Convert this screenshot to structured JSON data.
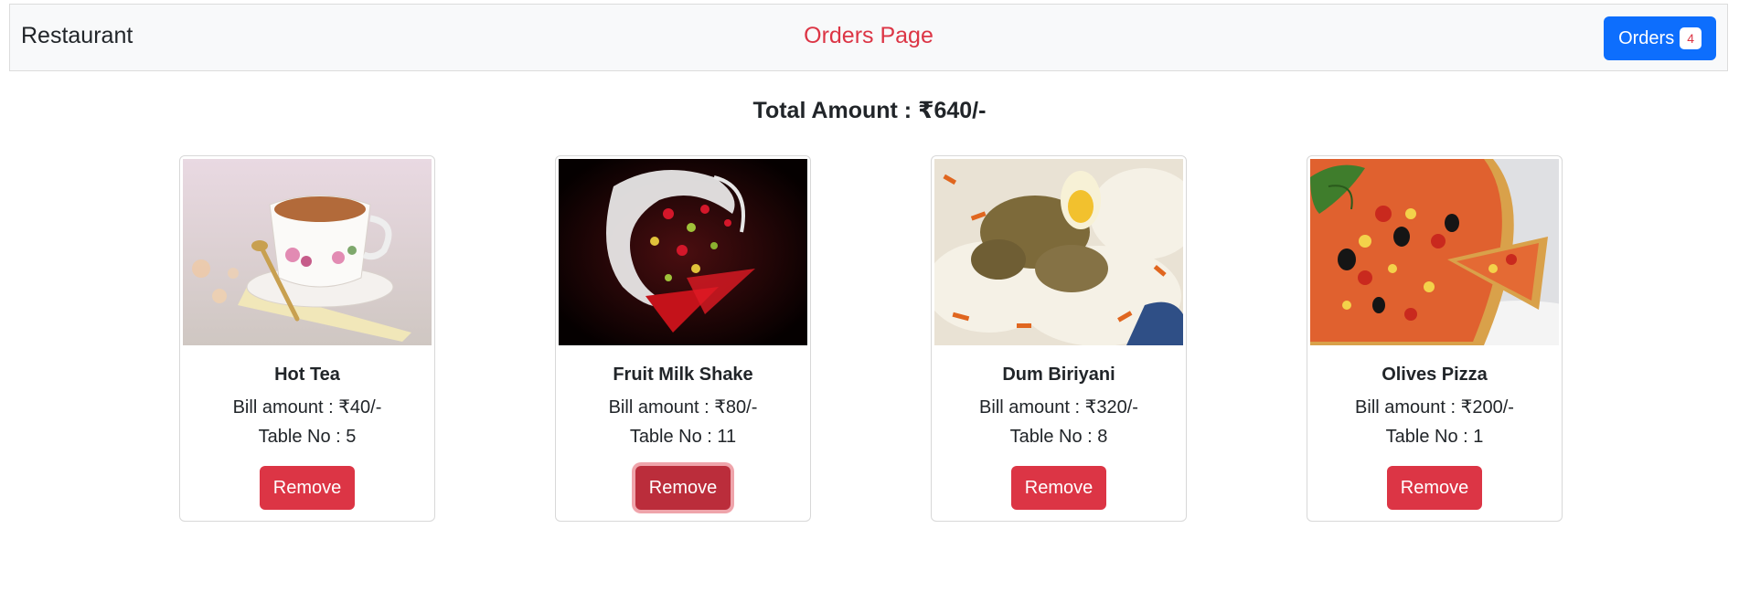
{
  "navbar": {
    "brand": "Restaurant",
    "title": "Orders Page",
    "orders_label": "Orders",
    "orders_count": "4"
  },
  "summary": {
    "total_text": "Total Amount : ₹640/-"
  },
  "orders": [
    {
      "name": "Hot Tea",
      "bill_text": "Bill amount : ₹40/-",
      "table_text": "Table No : 5",
      "remove_label": "Remove",
      "image": "tea-cup-photo"
    },
    {
      "name": "Fruit Milk Shake",
      "bill_text": "Bill amount : ₹80/-",
      "table_text": "Table No : 11",
      "remove_label": "Remove",
      "image": "milkshake-splash-photo",
      "focused": true
    },
    {
      "name": "Dum Biriyani",
      "bill_text": "Bill amount : ₹320/-",
      "table_text": "Table No : 8",
      "remove_label": "Remove",
      "image": "biriyani-photo"
    },
    {
      "name": "Olives Pizza",
      "bill_text": "Bill amount : ₹200/-",
      "table_text": "Table No : 1",
      "remove_label": "Remove",
      "image": "pizza-photo"
    }
  ],
  "colors": {
    "accent": "#dc3545",
    "primary": "#0d6efd",
    "navbar_bg": "#f8f9fa"
  }
}
